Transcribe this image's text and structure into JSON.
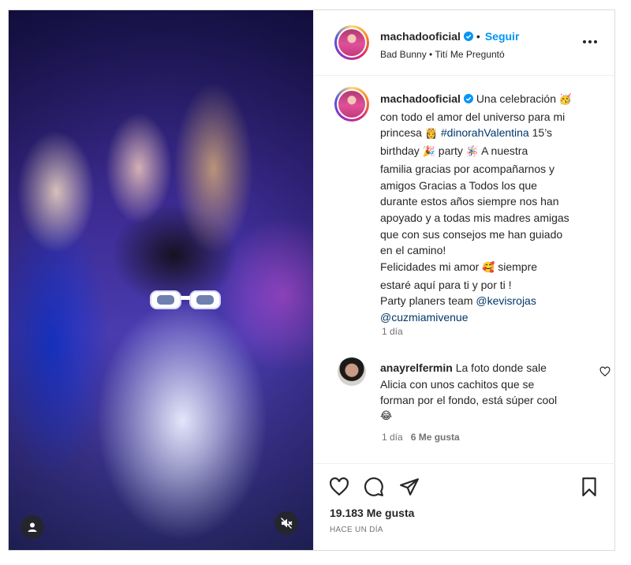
{
  "post": {
    "username": "machadooficial",
    "follow_label": "Seguir",
    "separator": "•",
    "music": "Bad Bunny • Tití Me Preguntó"
  },
  "caption": {
    "username": "machadooficial",
    "lines": [
      [
        "Una celebración ",
        "🥳"
      ],
      [
        "con todo el amor del universo para mi"
      ],
      [
        "princesa ",
        "👸",
        " ",
        "#dinorahValentina",
        " 15’s"
      ],
      [
        "birthday ",
        "🎉",
        " party ",
        "🪅",
        " A nuestra"
      ],
      [
        "familia gracias por acompañarnos y"
      ],
      [
        "amigos Gracias a Todos los que"
      ],
      [
        "durante estos años siempre nos han"
      ],
      [
        "apoyado y a todas mis madres amigas"
      ],
      [
        "que con sus consejos me han guiado"
      ],
      [
        "en el camino!"
      ],
      [
        "Felicidades mi amor ",
        "🥰",
        " siempre"
      ],
      [
        "estaré aquí para ti y por ti !"
      ],
      [
        "Party planers team ",
        "@kevisrojas"
      ],
      [
        "@cuzmiamivenue"
      ]
    ],
    "time": "1 día"
  },
  "comment": {
    "username": "anayrelfermin",
    "line1": "La foto donde sale",
    "line2": "Alicia con unos cachitos que se",
    "line3": "forman por el fondo, está súper cool",
    "line4": "😂",
    "time": "1 día",
    "likes": "6 Me gusta"
  },
  "footer": {
    "likes": "19.183 Me gusta",
    "posted": "HACE UN DÍA"
  },
  "colors": {
    "accent": "#0095f6",
    "link": "#00376b",
    "muted": "#737373"
  },
  "icons": [
    "verified-badge-icon",
    "more-options-icon",
    "heart-icon",
    "comment-icon",
    "share-icon",
    "bookmark-icon",
    "user-tag-icon",
    "mute-icon"
  ]
}
